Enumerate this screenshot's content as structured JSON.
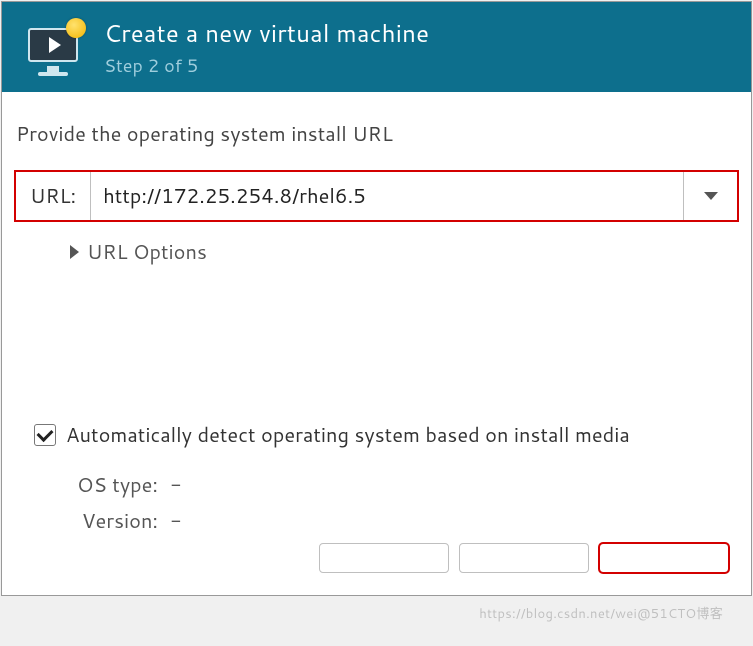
{
  "header": {
    "title": "Create a new virtual machine",
    "step": "Step 2 of 5"
  },
  "main": {
    "instruction": "Provide the operating system install URL",
    "url_label": "URL:",
    "url_value": "http://172.25.254.8/rhel6.5",
    "url_options_label": "URL Options",
    "auto_detect_label": "Automatically detect operating system based on install media",
    "auto_detect_checked": true,
    "os_type_label": "OS type:",
    "os_type_value": "-",
    "version_label": "Version:",
    "version_value": "-"
  },
  "buttons": {
    "cancel": "",
    "back": "",
    "forward": ""
  },
  "watermark": "https://blog.csdn.net/wei@51CTO博客"
}
